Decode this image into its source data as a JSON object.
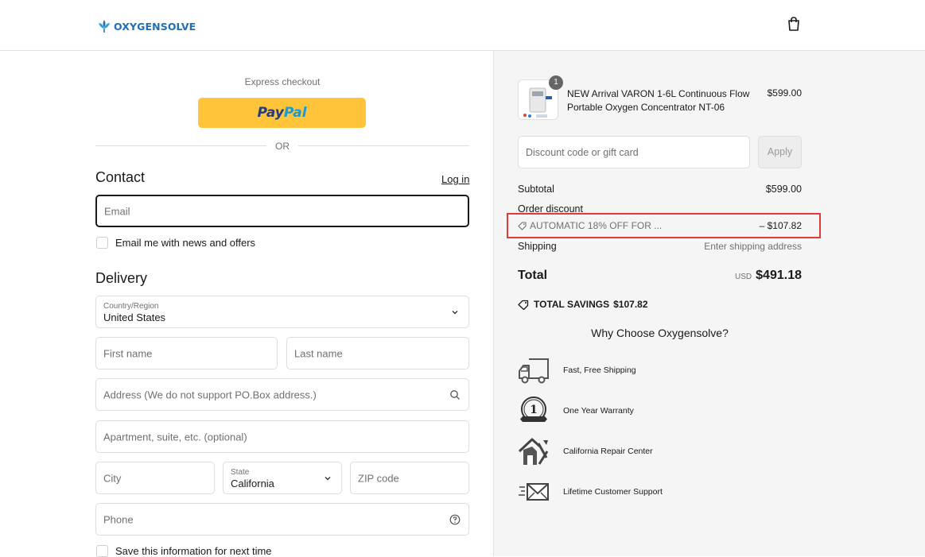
{
  "brand": {
    "name": "OXYGENSOLVE"
  },
  "express": {
    "label": "Express checkout",
    "paypal_pay": "Pay",
    "paypal_pal": "Pal",
    "or": "OR"
  },
  "contact": {
    "heading": "Contact",
    "login": "Log in",
    "email_placeholder": "Email",
    "news_checkbox": "Email me with news and offers"
  },
  "delivery": {
    "heading": "Delivery",
    "country_label": "Country/Region",
    "country_value": "United States",
    "first_name": "First name",
    "last_name": "Last name",
    "address": "Address (We do not support PO.Box address.)",
    "apartment": "Apartment, suite, etc. (optional)",
    "city": "City",
    "state_label": "State",
    "state_value": "California",
    "zip": "ZIP code",
    "phone": "Phone",
    "save_info": "Save this information for next time"
  },
  "summary": {
    "product": {
      "quantity": "1",
      "name": "NEW Arrival VARON 1-6L Continuous Flow Portable Oxygen Concentrator NT-06",
      "price": "$599.00"
    },
    "discount_placeholder": "Discount code or gift card",
    "apply": "Apply",
    "subtotal_label": "Subtotal",
    "subtotal_value": "$599.00",
    "order_discount_label": "Order discount",
    "discount_code": "AUTOMATIC 18% OFF FOR ...",
    "discount_value": "– $107.82",
    "shipping_label": "Shipping",
    "shipping_value": "Enter shipping address",
    "total_label": "Total",
    "currency": "USD",
    "total_value": "$491.18",
    "savings_label": "TOTAL SAVINGS",
    "savings_value": "$107.82"
  },
  "why": {
    "title": "Why Choose Oxygensolve?",
    "items": [
      {
        "icon": "truck-icon",
        "text": "Fast, Free Shipping"
      },
      {
        "icon": "warranty-badge-icon",
        "text": "One Year Warranty"
      },
      {
        "icon": "repair-house-icon",
        "text": "California Repair Center"
      },
      {
        "icon": "fast-mail-icon",
        "text": "Lifetime Customer Support"
      }
    ]
  },
  "colors": {
    "accent": "#1f6fb8",
    "paypal": "#ffc439",
    "highlight": "#e23a3a",
    "panel_bg": "#f5f5f5"
  }
}
